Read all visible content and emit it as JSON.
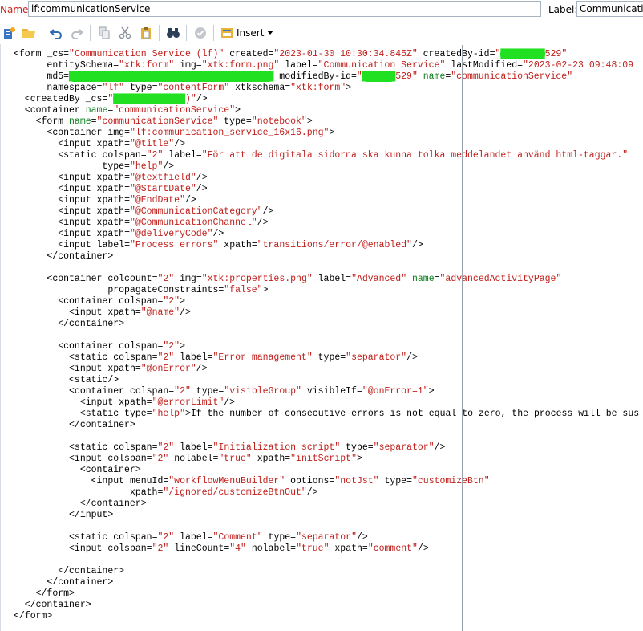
{
  "header": {
    "name_label": "Name:",
    "name_value": "lf:communicationService",
    "label_label": "Label:",
    "label_value": "Communication Service (lf)"
  },
  "toolbar": {
    "insert_label": "Insert"
  },
  "code_lines": [
    "<form _cs=\"Communication Service (lf)\" created=\"2023-01-30 10:30:34.845Z\" createdBy-id=\"████████529\"",
    "      entitySchema=\"xtk:form\" img=\"xtk:form.png\" label=\"Communication Service\" lastModified=\"2023-02-23 09:48:09",
    "      md5=\"█████████████████████████████████████\" modifiedBy-id=\"██████529\" name=\"communicationService\"",
    "      namespace=\"lf\" type=\"contentForm\" xtkschema=\"xtk:form\">",
    "  <createdBy _cs=\"█████████████)\"/>",
    "  <container name=\"communicationService\">",
    "    <form name=\"communicationService\" type=\"notebook\">",
    "      <container img=\"lf:communication_service_16x16.png\">",
    "        <input xpath=\"@title\"/>",
    "        <static colspan=\"2\" label=\"För att de digitala sidorna ska kunna tolka meddelandet använd html-taggar.\"",
    "                type=\"help\"/>",
    "        <input xpath=\"@textfield\"/>",
    "        <input xpath=\"@StartDate\"/>",
    "        <input xpath=\"@EndDate\"/>",
    "        <input xpath=\"@CommunicationCategory\"/>",
    "        <input xpath=\"@CommunicationChannel\"/>",
    "        <input xpath=\"@deliveryCode\"/>",
    "        <input label=\"Process errors\" xpath=\"transitions/error/@enabled\"/>",
    "      </container>",
    "",
    "      <container colcount=\"2\" img=\"xtk:properties.png\" label=\"Advanced\" name=\"advancedActivityPage\"",
    "                 propagateConstraints=\"false\">",
    "        <container colspan=\"2\">",
    "          <input xpath=\"@name\"/>",
    "        </container>",
    "",
    "        <container colspan=\"2\">",
    "          <static colspan=\"2\" label=\"Error management\" type=\"separator\"/>",
    "          <input xpath=\"@onError\"/>",
    "          <static/>",
    "          <container colspan=\"2\" type=\"visibleGroup\" visibleIf=\"@onError=1\">",
    "            <input xpath=\"@errorLimit\"/>",
    "            <static type=\"help\">If the number of consecutive errors is not equal to zero, the process will be sus",
    "          </container>",
    "",
    "          <static colspan=\"2\" label=\"Initialization script\" type=\"separator\"/>",
    "          <input colspan=\"2\" nolabel=\"true\" xpath=\"initScript\">",
    "            <container>",
    "              <input menuId=\"workflowMenuBuilder\" options=\"notJst\" type=\"customizeBtn\"",
    "                     xpath=\"/ignored/customizeBtnOut\"/>",
    "            </container>",
    "          </input>",
    "",
    "          <static colspan=\"2\" label=\"Comment\" type=\"separator\"/>",
    "          <input colspan=\"2\" lineCount=\"4\" nolabel=\"true\" xpath=\"comment\"/>",
    "",
    "        </container>",
    "      </container>",
    "    </form>",
    "  </container>",
    "</form>"
  ],
  "colors": {
    "value": "#c0201c",
    "name_attr": "#0a7d1b",
    "redaction": "#21e021"
  }
}
